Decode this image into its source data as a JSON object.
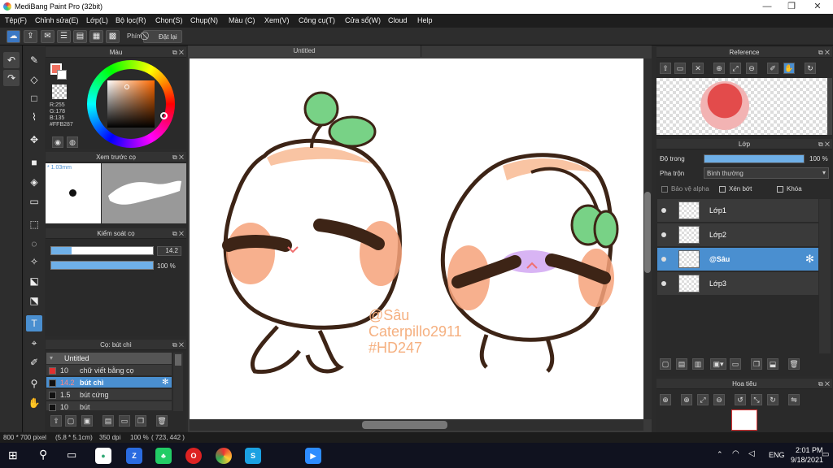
{
  "window": {
    "title": "MediBang Paint Pro (32bit)",
    "minimize": "—",
    "maximize": "❐",
    "close": "✕"
  },
  "menu": [
    "Tệp(F)",
    "Chỉnh sửa(E)",
    "Lớp(L)",
    "Bộ lọc(R)",
    "Chọn(S)",
    "Chụp(N)",
    "Màu (C)",
    "Xem(V)",
    "Công cụ(T)",
    "Cửa sổ(W)",
    "Cloud",
    "Help"
  ],
  "toolbar": {
    "keys_label": "Phím",
    "reset_label": "Đặt lại"
  },
  "color_panel": {
    "title": "Màu",
    "r": "R:255",
    "g": "G:178",
    "b": "B:135",
    "hex": "#FFB287",
    "foreground": "#f07060",
    "hue_square": "#ff6a00"
  },
  "brush_preview_panel": {
    "title": "Xem trước cọ",
    "size_text": "* 1.03mm"
  },
  "brush_control_panel": {
    "title": "Kiểm soát cọ",
    "size_value": "14.2",
    "opacity_value": "100 %",
    "size_fraction": 0.2,
    "opacity_fraction": 1.0
  },
  "brush_list_panel": {
    "title": "Cọ: bút chì",
    "group": "Untitled",
    "items": [
      {
        "size": "10",
        "name": "chữ viết bằng cọ",
        "color": "#e03030"
      },
      {
        "size": "14.2",
        "name": "bút chì",
        "color": "#111111"
      },
      {
        "size": "1.5",
        "name": "bút cứng",
        "color": "#111111"
      },
      {
        "size": "10",
        "name": "bút",
        "color": "#111111"
      }
    ]
  },
  "canvas": {
    "tab": "Untitled",
    "watermark": [
      "@Sâu",
      "Caterpillo2911",
      "#HD247"
    ],
    "watermark_color": "#f5b080"
  },
  "reference_panel": {
    "title": "Reference"
  },
  "layer_panel": {
    "title": "Lớp",
    "opacity_label": "Độ trong",
    "opacity_value": "100 %",
    "opacity_fraction": 1.0,
    "blend_label": "Pha trộn",
    "blend_value": "Bình thường",
    "protect_alpha": "Bảo vệ alpha",
    "clipping": "Xén bớt",
    "lock": "Khóa",
    "layers": [
      "Lớp1",
      "Lớp2",
      "@Sâu",
      "Lớp3"
    ]
  },
  "navigator_panel": {
    "title": "Hoa tiêu"
  },
  "status": {
    "size": "800 * 700 pixel",
    "cm": "(5.8 * 5.1cm)",
    "dpi": "350 dpi",
    "zoom": "100 %",
    "coords": "( 723, 442 )"
  },
  "taskbar": {
    "lang": "ENG",
    "time": "2:01 PM",
    "date": "9/18/2021"
  },
  "colors": {
    "accent": "#4a8fd0",
    "peach": "#f9c4a3",
    "cheek": "#f6a27a",
    "outline": "#3d2416",
    "leaf": "#78d286"
  }
}
